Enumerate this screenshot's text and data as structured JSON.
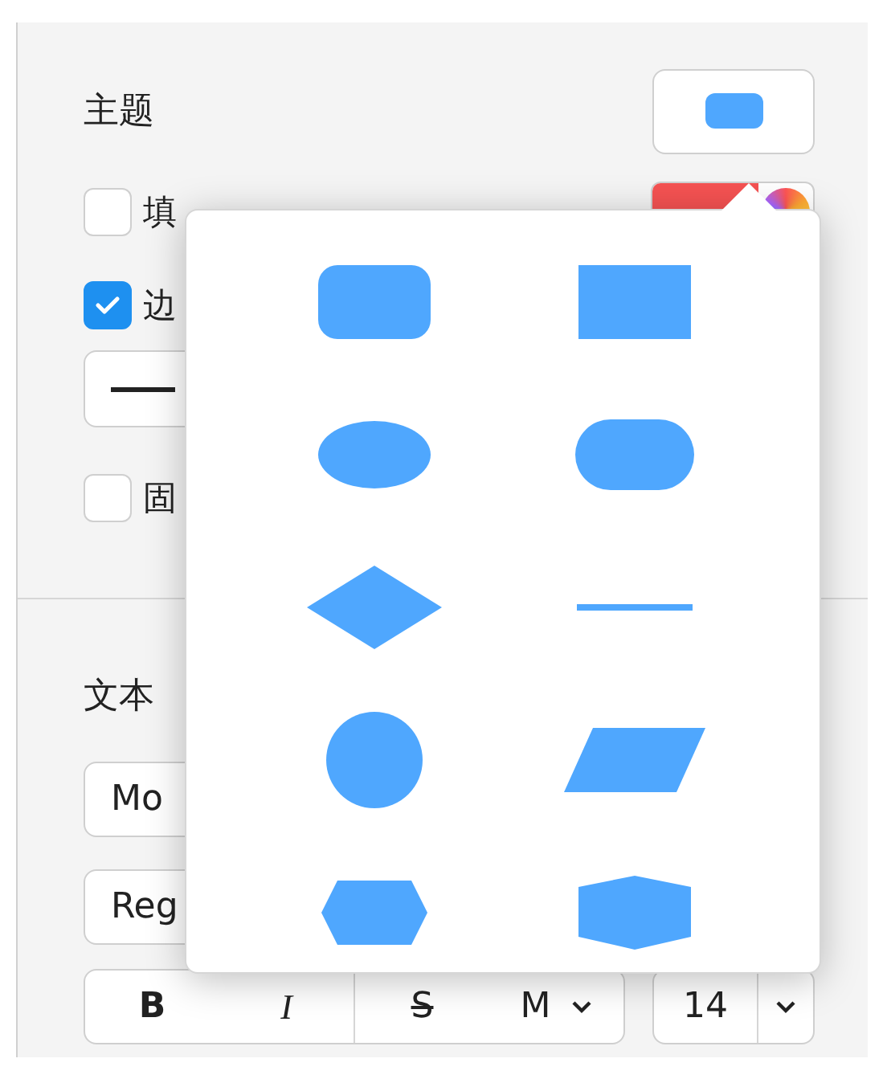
{
  "style_section": {
    "title": "主题",
    "style_preview": {
      "kind": "rounded-rect"
    },
    "options": [
      {
        "kind": "checkbox",
        "label": "填",
        "checked": false,
        "color": "#f55252"
      },
      {
        "kind": "checkbox",
        "label": "边",
        "checked": true
      },
      {
        "kind": "line-style"
      },
      {
        "kind": "checkbox",
        "label": "固",
        "checked": false
      }
    ]
  },
  "text_section": {
    "title": "文本",
    "font": "Mo",
    "weight": "Reg",
    "format_buttons": [
      {
        "kind": "bold",
        "label": "B"
      },
      {
        "kind": "italic",
        "label": "I"
      },
      {
        "kind": "strike",
        "label": "S"
      },
      {
        "kind": "menu",
        "label": "M"
      }
    ],
    "size": "14"
  },
  "shape_popover": {
    "shapes": [
      {
        "kind": "rounded-rect"
      },
      {
        "kind": "rect"
      },
      {
        "kind": "ellipse"
      },
      {
        "kind": "stadium"
      },
      {
        "kind": "diamond"
      },
      {
        "kind": "line"
      },
      {
        "kind": "circle"
      },
      {
        "kind": "parallelogram"
      },
      {
        "kind": "hexagon"
      },
      {
        "kind": "pentagon-hexagon"
      }
    ]
  }
}
